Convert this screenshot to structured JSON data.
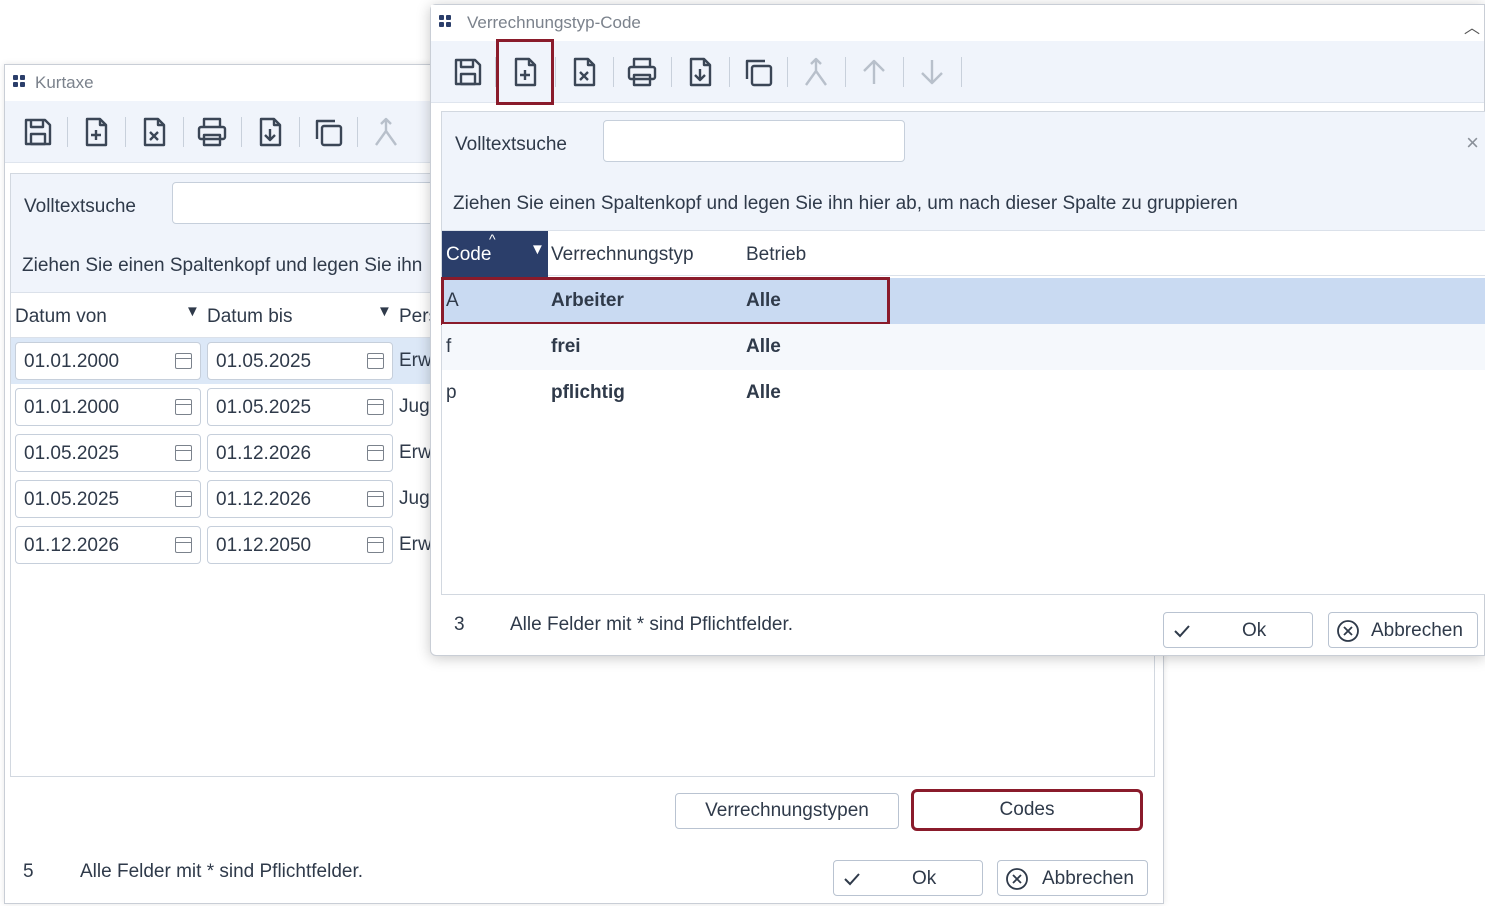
{
  "back_window": {
    "title": "Kurtaxe",
    "search_label": "Volltextsuche",
    "search_value": "",
    "group_hint": "Ziehen Sie einen Spaltenkopf und legen Sie ihn",
    "columns": [
      "Datum von",
      "Datum bis",
      "Pers"
    ],
    "rows": [
      {
        "von": "01.01.2000",
        "bis": "01.05.2025",
        "pers": "Erw"
      },
      {
        "von": "01.01.2000",
        "bis": "01.05.2025",
        "pers": "Juge"
      },
      {
        "von": "01.05.2025",
        "bis": "01.12.2026",
        "pers": "Erw"
      },
      {
        "von": "01.05.2025",
        "bis": "01.12.2026",
        "pers": "Juge"
      },
      {
        "von": "01.12.2026",
        "bis": "01.12.2050",
        "pers": "Erw"
      }
    ],
    "btn_verrechnungstypen": "Verrechnungstypen",
    "btn_codes": "Codes",
    "count": "5",
    "required_note": "Alle Felder mit * sind Pflichtfelder.",
    "ok_label": "Ok",
    "cancel_label": "Abbrechen"
  },
  "front_window": {
    "title": "Verrechnungstyp-Code",
    "search_label": "Volltextsuche",
    "search_value": "",
    "group_hint": "Ziehen Sie einen Spaltenkopf und legen Sie ihn hier ab, um nach dieser Spalte zu gruppieren",
    "columns": [
      "Code",
      "Verrechnungstyp",
      "Betrieb"
    ],
    "rows": [
      {
        "code": "A",
        "typ": "Arbeiter",
        "betrieb": "Alle"
      },
      {
        "code": "f",
        "typ": "frei",
        "betrieb": "Alle"
      },
      {
        "code": "p",
        "typ": "pflichtig",
        "betrieb": "Alle"
      }
    ],
    "count": "3",
    "required_note": "Alle Felder mit * sind Pflichtfelder.",
    "ok_label": "Ok",
    "cancel_label": "Abbrechen"
  },
  "colors": {
    "accent_dark": "#2b3e6a",
    "highlight_border": "#8a1b2b",
    "selected_row": "#c9daf2",
    "toolbar_bg": "#f0f4fb"
  }
}
